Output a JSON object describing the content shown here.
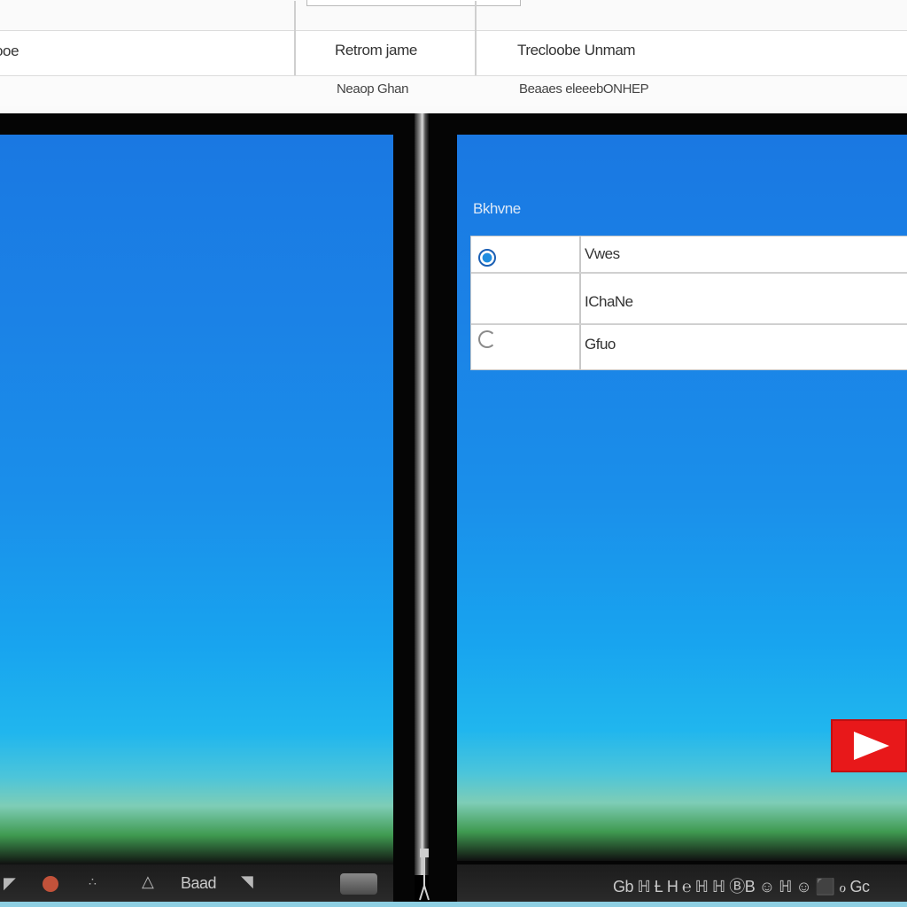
{
  "header": {
    "row1": {
      "col1": "ooe",
      "col2": "Retrom jame",
      "col3": "Trecloobe Unmam"
    },
    "row2": {
      "col2": "Neaop Ghan",
      "col3": "Beaaes eleeebONHEP"
    }
  },
  "right_pane": {
    "section_label": "Bkhvne",
    "options": [
      {
        "label": "Vwes",
        "state": "checked"
      },
      {
        "label": "IChaNe",
        "state": "none"
      },
      {
        "label": "Gfuo",
        "state": "partial"
      }
    ]
  },
  "bottom_bar_left": {
    "text": "Baad"
  },
  "bottom_bar_right": {
    "text": "Gb  ℍ  Ƚ  H  ℮  ℍ  ℍ  ⒷB  ☺  ℍ  ☺  ⬛  ℴ  Gc"
  },
  "icons": {
    "play": "play-icon",
    "warning": "warning-triangle-icon",
    "wifi": "wifi-icon",
    "volume": "volume-icon"
  },
  "colors": {
    "sky_top": "#1a78e2",
    "accent_red": "#e8181a",
    "radio_selected": "#1f8de0"
  }
}
